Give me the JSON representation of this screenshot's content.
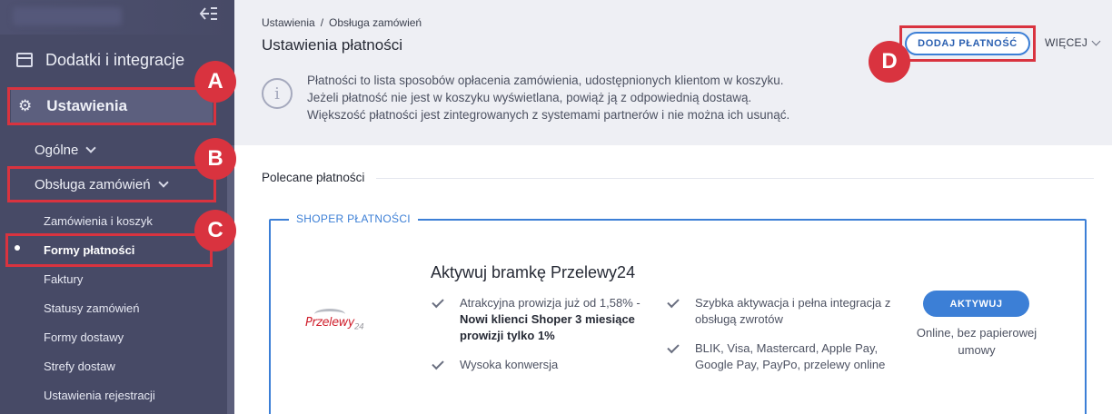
{
  "sidebar": {
    "items": [
      {
        "label": "Dodatki i integracje",
        "icon": "calendar-icon"
      },
      {
        "label": "Ustawienia",
        "icon": "gear-icon"
      }
    ],
    "sub": {
      "ogolne": "Ogólne",
      "obsluga": "Obsługa zamówień",
      "leaves": [
        "Zamówienia i koszyk",
        "Formy płatności",
        "Faktury",
        "Statusy zamówień",
        "Formy dostawy",
        "Strefy dostaw",
        "Ustawienia rejestracji"
      ],
      "active_index": 1
    }
  },
  "header": {
    "breadcrumb": [
      "Ustawienia",
      "Obsługa zamówień"
    ],
    "breadcrumb_sep": "/",
    "title": "Ustawienia płatności",
    "info_lines": [
      "Płatności to lista sposobów opłacenia zamówienia, udostępnionych klientom w koszyku.",
      "Jeżeli płatność nie jest w koszyku wyświetlana, powiąż ją z odpowiednią dostawą.",
      "Większość płatności jest zintegrowanych z systemami partnerów i nie można ich usunąć."
    ],
    "add_button": "DODAJ PŁATNOŚĆ",
    "more": "WIĘCEJ"
  },
  "main": {
    "section_title": "Polecane płatności",
    "panel_legend": "SHOPER PŁATNOŚCI",
    "logo_text": "Przelewy",
    "logo_num": "24",
    "promo_title": "Aktywuj bramkę Przelewy24",
    "features": {
      "f1_a": "Atrakcyjna prowizja już od 1,58% -",
      "f1_b": "Nowi klienci Shoper 3 miesiące prowizji tylko 1%",
      "f2": "Wysoka konwersja",
      "f3": "Szybka aktywacja i pełna integracja z obsługą zwrotów",
      "f4": "BLIK, Visa, Mastercard, Apple Pay, Google Pay, PayPo, przelewy online"
    },
    "activate_button": "AKTYWUJ",
    "activate_note": "Online, bez papierowej umowy"
  },
  "annotations": {
    "a": "A",
    "b": "B",
    "c": "C",
    "d": "D",
    "color": "#d9333f"
  },
  "colors": {
    "sidebar_bg": "#474a66",
    "accent": "#3c7fd6",
    "header_bg": "#eeeff4"
  }
}
